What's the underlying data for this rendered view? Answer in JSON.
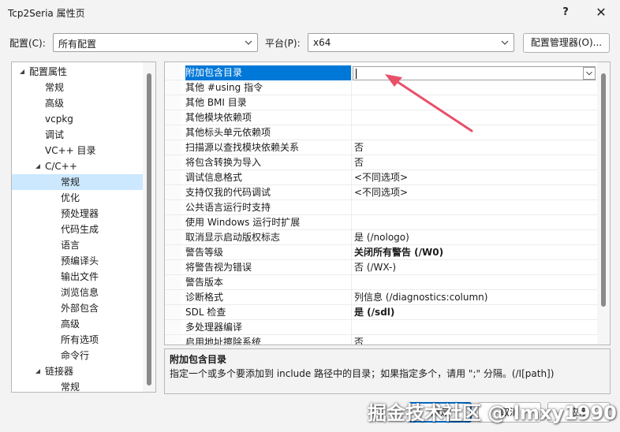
{
  "window": {
    "title": "Tcp2Seria 属性页",
    "help_label": "?",
    "close_label": "✕"
  },
  "config": {
    "config_label": "配置(C):",
    "config_value": "所有配置",
    "platform_label": "平台(P):",
    "platform_value": "x64",
    "manager_button": "配置管理器(O)..."
  },
  "tree": {
    "items": [
      {
        "label": "配置属性",
        "level": 0,
        "expanded": true
      },
      {
        "label": "常规",
        "level": 1
      },
      {
        "label": "高级",
        "level": 1
      },
      {
        "label": "vcpkg",
        "level": 1
      },
      {
        "label": "调试",
        "level": 1
      },
      {
        "label": "VC++ 目录",
        "level": 1
      },
      {
        "label": "C/C++",
        "level": 1,
        "expanded": true
      },
      {
        "label": "常规",
        "level": 2,
        "selected": true
      },
      {
        "label": "优化",
        "level": 2
      },
      {
        "label": "预处理器",
        "level": 2
      },
      {
        "label": "代码生成",
        "level": 2
      },
      {
        "label": "语言",
        "level": 2
      },
      {
        "label": "预编译头",
        "level": 2
      },
      {
        "label": "输出文件",
        "level": 2
      },
      {
        "label": "浏览信息",
        "level": 2
      },
      {
        "label": "外部包含",
        "level": 2
      },
      {
        "label": "高级",
        "level": 2
      },
      {
        "label": "所有选项",
        "level": 2
      },
      {
        "label": "命令行",
        "level": 2
      },
      {
        "label": "链接器",
        "level": 1,
        "expanded": true
      },
      {
        "label": "常规",
        "level": 2
      }
    ]
  },
  "grid": {
    "rows": [
      {
        "name": "附加包含目录",
        "value": "",
        "selected": true
      },
      {
        "name": "其他 #using 指令",
        "value": ""
      },
      {
        "name": "其他 BMI 目录",
        "value": ""
      },
      {
        "name": "其他模块依赖项",
        "value": ""
      },
      {
        "name": "其他标头单元依赖项",
        "value": ""
      },
      {
        "name": "扫描源以查找模块依赖关系",
        "value": "否"
      },
      {
        "name": "将包含转换为导入",
        "value": "否"
      },
      {
        "name": "调试信息格式",
        "value": "<不同选项>"
      },
      {
        "name": "支持仅我的代码调试",
        "value": "<不同选项>"
      },
      {
        "name": "公共语言运行时支持",
        "value": ""
      },
      {
        "name": "使用 Windows 运行时扩展",
        "value": ""
      },
      {
        "name": "取消显示启动版权标志",
        "value": "是 (/nologo)"
      },
      {
        "name": "警告等级",
        "value": "关闭所有警告 (/W0)",
        "bold": true
      },
      {
        "name": "将警告视为错误",
        "value": "否 (/WX-)"
      },
      {
        "name": "警告版本",
        "value": ""
      },
      {
        "name": "诊断格式",
        "value": "列信息 (/diagnostics:column)"
      },
      {
        "name": "SDL 检查",
        "value": "是 (/sdl)",
        "bold": true
      },
      {
        "name": "多处理器编译",
        "value": ""
      },
      {
        "name": "启用地址擦除系统",
        "value": "否"
      }
    ]
  },
  "description": {
    "title": "附加包含目录",
    "text": "指定一个或多个要添加到 include 路径中的目录；如果指定多个，请用 \";\" 分隔。(/I[path])"
  },
  "buttons": {
    "ok": "确定",
    "cancel": "取消",
    "apply": "应用"
  },
  "watermark": "掘金技术社区 @ lmxy1990",
  "colors": {
    "selection": "#0078d7",
    "tree_selection": "#cce8ff",
    "annotation_arrow": "#e8506a"
  }
}
